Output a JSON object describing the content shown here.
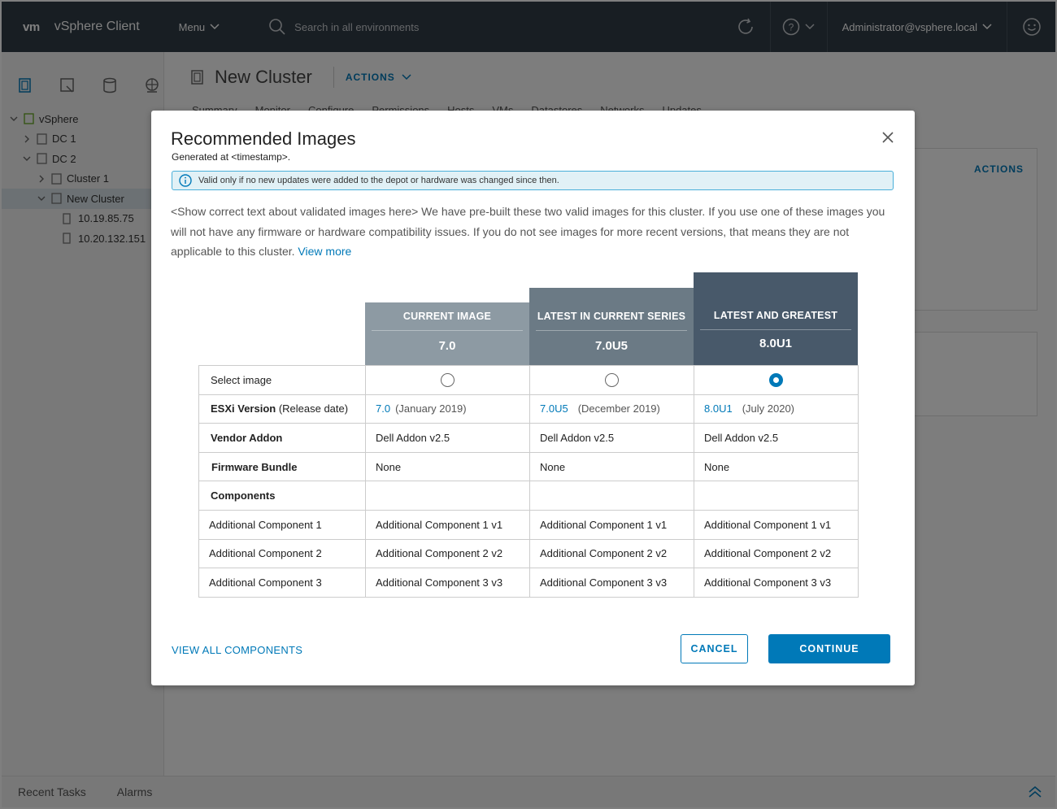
{
  "topbar": {
    "logo": "vm",
    "app_title": "vSphere Client",
    "menu_label": "Menu",
    "search_placeholder": "Search in all environments",
    "user_label": "Administrator@vsphere.local"
  },
  "sidebar": {
    "tree": [
      {
        "label": "vSphere",
        "level": 0
      },
      {
        "label": "DC 1",
        "level": 1
      },
      {
        "label": "DC 2",
        "level": 1
      },
      {
        "label": "Cluster 1",
        "level": 2
      },
      {
        "label": "New Cluster",
        "level": 2,
        "selected": true
      },
      {
        "label": "10.19.85.75",
        "level": 3
      },
      {
        "label": "10.20.132.151",
        "level": 3
      }
    ]
  },
  "main": {
    "title": "New Cluster",
    "actions_label": "ACTIONS",
    "tabs": [
      "Summary",
      "Monitor",
      "Configure",
      "Permissions",
      "Hosts",
      "VMs",
      "Datastores",
      "Networks",
      "Updates"
    ],
    "card_actions_label": "ACTIONS"
  },
  "bottombar": {
    "recent_tasks": "Recent Tasks",
    "alarms": "Alarms"
  },
  "modal": {
    "title": "Recommended Images",
    "subtitle": "Generated at <timestamp>.",
    "info_text": "Valid only if no new updates were added to the depot or hardware was changed since then.",
    "description": "<Show correct text about validated images here> We have pre-built these two valid images for this cluster. If you use one of these images you will not have any firmware or hardware compatibility issues. If you do not see images for more recent versions, that means they are not applicable to this cluster.",
    "view_more": "View more",
    "columns": [
      {
        "header": "CURRENT IMAGE",
        "version": "7.0",
        "color": "#8d9aa3"
      },
      {
        "header": "LATEST IN CURRENT SERIES",
        "version": "7.0U5",
        "color": "#6b7a85"
      },
      {
        "header": "LATEST AND GREATEST",
        "version": "8.0U1",
        "color": "#48596a"
      }
    ],
    "rows": {
      "select_label": "Select image",
      "selected_index": 2,
      "esxi_label_bold": "ESXi Version",
      "esxi_label_rest": " (Release date)",
      "esxi": [
        {
          "version": "7.0",
          "date": "(January 2019)"
        },
        {
          "version": "7.0U5",
          "date": "(December 2019)"
        },
        {
          "version": "8.0U1",
          "date": "(July 2020)"
        }
      ],
      "vendor_label": "Vendor Addon",
      "vendor": [
        "Dell Addon v2.5",
        "Dell Addon v2.5",
        "Dell Addon v2.5"
      ],
      "firmware_label": "Firmware Bundle",
      "firmware": [
        "None",
        "None",
        "None"
      ],
      "components_label": "Components",
      "components": [
        {
          "label": "Additional Component 1",
          "values": [
            "Additional Component 1 v1",
            "Additional Component 1 v1",
            "Additional Component 1 v1"
          ]
        },
        {
          "label": "Additional Component 2",
          "values": [
            "Additional Component 2 v2",
            "Additional Component 2 v2",
            "Additional Component 2 v2"
          ]
        },
        {
          "label": "Additional Component 3",
          "values": [
            "Additional Component 3 v3",
            "Additional Component 3 v3",
            "Additional Component 3 v3"
          ]
        }
      ]
    },
    "view_all_label": "VIEW ALL COMPONENTS",
    "cancel_label": "CANCEL",
    "continue_label": "CONTINUE",
    "accent_color": "#0079b8"
  }
}
